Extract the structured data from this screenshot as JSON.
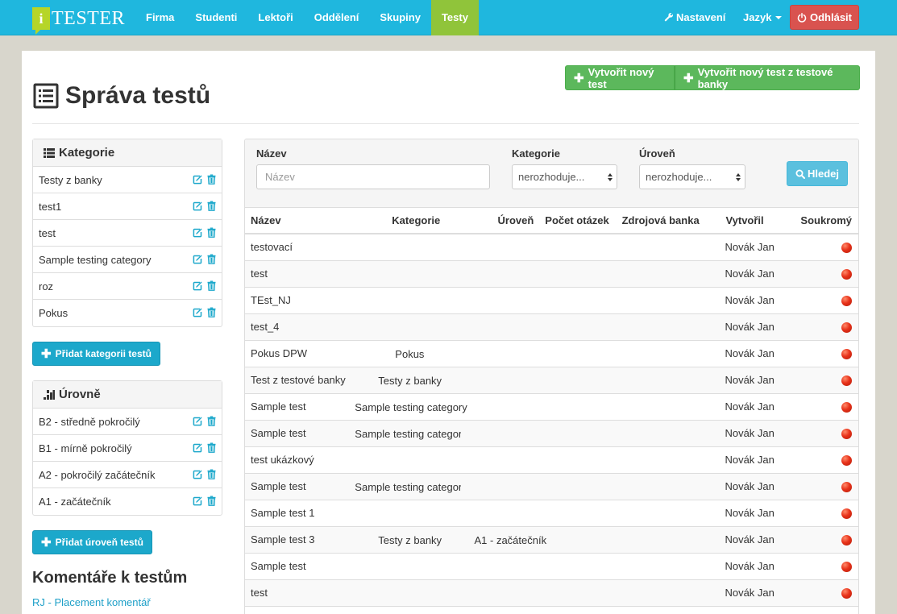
{
  "brand": {
    "logo_letter": "i",
    "name": "TESTER"
  },
  "nav": {
    "items": [
      "Firma",
      "Studenti",
      "Lektoři",
      "Oddělení",
      "Skupiny",
      "Testy"
    ],
    "active": "Testy",
    "settings_label": "Nastavení",
    "language_label": "Jazyk",
    "logout_label": "Odhlásit"
  },
  "page": {
    "title": "Správa testů",
    "create_label": "Vytvořit nový test",
    "create_from_bank_label": "Vytvořit nový test z testové banky"
  },
  "categories": {
    "title": "Kategorie",
    "items": [
      "Testy z banky",
      "test1",
      "test",
      "Sample testing category",
      "roz",
      "Pokus"
    ],
    "add_label": "Přidat kategorii testů"
  },
  "levels": {
    "title": "Úrovně",
    "items": [
      "B2 - středně pokročilý",
      "B1 - mírně pokročilý",
      "A2 - pokročilý začátečník",
      "A1 - začátečník"
    ],
    "add_label": "Přidat úroveň testů"
  },
  "comments": {
    "title": "Komentáře k testům",
    "link": "RJ - Placement komentář"
  },
  "filter": {
    "name_label": "Název",
    "name_placeholder": "Název",
    "category_label": "Kategorie",
    "category_value": "nerozhoduje...",
    "level_label": "Úroveň",
    "level_value": "nerozhoduje...",
    "search_label": "Hledej"
  },
  "table": {
    "headers": [
      "Název",
      "Kategorie",
      "Úroveň",
      "Počet otázek",
      "Zdrojová banka",
      "Vytvořil",
      "Soukromý"
    ],
    "rows": [
      {
        "name": "testovací",
        "category": "",
        "level": "",
        "author": "Novák Jan"
      },
      {
        "name": "test",
        "category": "",
        "level": "",
        "author": "Novák Jan"
      },
      {
        "name": "TEst_NJ",
        "category": "",
        "level": "",
        "author": "Novák Jan"
      },
      {
        "name": "test_4",
        "category": "",
        "level": "",
        "author": "Novák Jan"
      },
      {
        "name": "Pokus DPW",
        "category": "Pokus",
        "level": "",
        "author": "Novák Jan"
      },
      {
        "name": "Test z testové banky",
        "category": "Testy z banky",
        "level": "",
        "author": "Novák Jan"
      },
      {
        "name": "Sample test",
        "category": "Sample testing category",
        "level": "",
        "author": "Novák Jan"
      },
      {
        "name": "Sample test",
        "category": "Sample testing category",
        "level": "",
        "author": "Novák Jan"
      },
      {
        "name": "test ukázkový",
        "category": "",
        "level": "",
        "author": "Novák Jan"
      },
      {
        "name": "Sample test",
        "category": "Sample testing category",
        "level": "",
        "author": "Novák Jan"
      },
      {
        "name": "Sample test 1",
        "category": "",
        "level": "",
        "author": "Novák Jan"
      },
      {
        "name": "Sample test 3",
        "category": "Testy z banky",
        "level": "A1 - začátečník",
        "author": "Novák Jan"
      },
      {
        "name": "Sample test",
        "category": "",
        "level": "",
        "author": "Novák Jan"
      },
      {
        "name": "test",
        "category": "",
        "level": "",
        "author": "Novák Jan"
      }
    ]
  },
  "colors": {
    "nav": "#1fb7de",
    "active_nav": "#90c43a",
    "logout": "#d9534f",
    "create": "#5cb85c",
    "add": "#1ca8cb",
    "search": "#5bc0de",
    "private_dot": "#e8321a"
  }
}
